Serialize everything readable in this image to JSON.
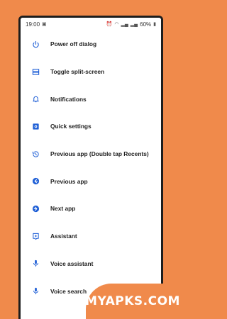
{
  "status": {
    "time": "19:00",
    "battery": "60%"
  },
  "items": [
    {
      "label": "Power off dialog",
      "icon": "power-icon"
    },
    {
      "label": "Toggle split-screen",
      "icon": "split-screen-icon"
    },
    {
      "label": "Notifications",
      "icon": "bell-icon"
    },
    {
      "label": "Quick settings",
      "icon": "settings-icon"
    },
    {
      "label": "Previous app (Double tap Recents)",
      "icon": "history-icon"
    },
    {
      "label": "Previous app",
      "icon": "arrow-left-circle-icon"
    },
    {
      "label": "Next app",
      "icon": "arrow-right-circle-icon"
    },
    {
      "label": "Assistant",
      "icon": "assistant-icon"
    },
    {
      "label": "Voice assistant",
      "icon": "mic-icon"
    },
    {
      "label": "Voice search",
      "icon": "mic-icon"
    }
  ],
  "watermark": "MYAPKS.COM",
  "colors": {
    "background": "#f08a4b",
    "accent": "#1f5fd6"
  }
}
